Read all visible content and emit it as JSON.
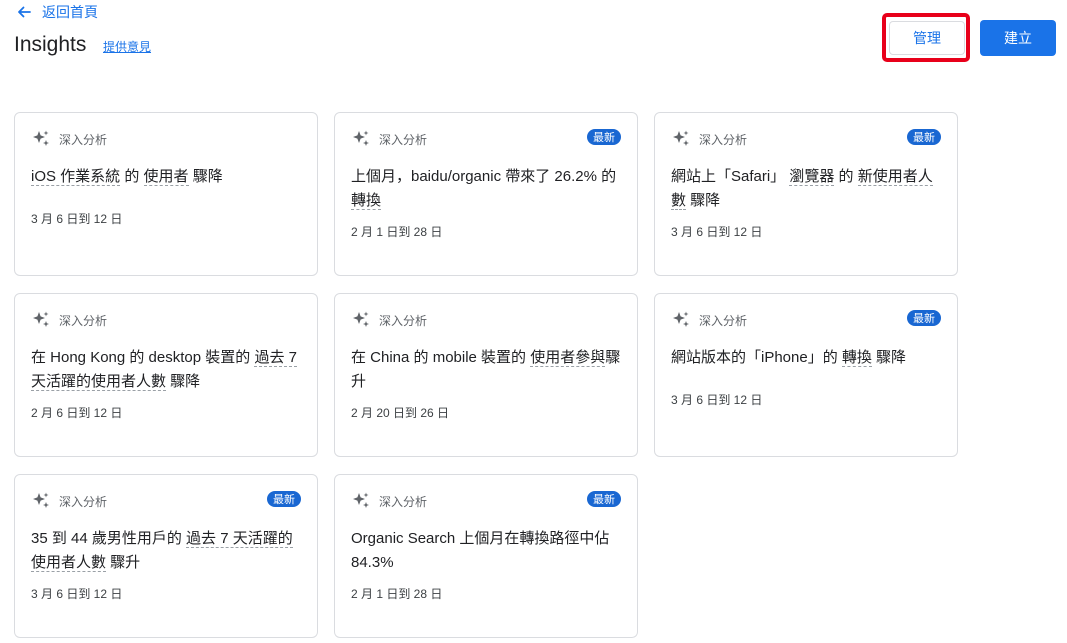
{
  "header": {
    "back_label": "返回首頁",
    "title": "Insights",
    "feedback_label": "提供意見",
    "manage_label": "管理",
    "create_label": "建立"
  },
  "colors": {
    "accent": "#1a73e8",
    "badge": "#1967d2",
    "highlight": "#e8001a"
  },
  "cards": [
    {
      "kind": "深入分析",
      "badge": "",
      "title": [
        [
          "iOS 作業系統",
          true
        ],
        [
          " 的 ",
          false
        ],
        [
          "使用者",
          true
        ],
        [
          " 驟降",
          false
        ]
      ],
      "date": "3 月 6 日到 12 日"
    },
    {
      "kind": "深入分析",
      "badge": "最新",
      "title": [
        [
          "上個月，baidu/organic 帶來了 26.2% 的 ",
          false
        ],
        [
          "轉換",
          true
        ]
      ],
      "date": "2 月 1 日到 28 日"
    },
    {
      "kind": "深入分析",
      "badge": "最新",
      "title": [
        [
          "網站上「Safari」 ",
          false
        ],
        [
          "瀏覽器",
          true
        ],
        [
          " 的 ",
          false
        ],
        [
          "新使用者人數",
          true
        ],
        [
          " 驟降",
          false
        ]
      ],
      "date": "3 月 6 日到 12 日"
    },
    {
      "kind": "深入分析",
      "badge": "",
      "title": [
        [
          "在 Hong Kong 的 desktop 裝置的 ",
          false
        ],
        [
          "過去 7 天活躍的使用者人數",
          true
        ],
        [
          " 驟降",
          false
        ]
      ],
      "date": "2 月 6 日到 12 日"
    },
    {
      "kind": "深入分析",
      "badge": "",
      "title": [
        [
          "在 China 的 mobile 裝置的 ",
          false
        ],
        [
          "使用者參與",
          true
        ],
        [
          "驟升",
          false
        ]
      ],
      "date": "2 月 20 日到 26 日"
    },
    {
      "kind": "深入分析",
      "badge": "最新",
      "title": [
        [
          "網站版本的「iPhone」的 ",
          false
        ],
        [
          "轉換",
          true
        ],
        [
          " 驟降",
          false
        ]
      ],
      "date": "3 月 6 日到 12 日"
    },
    {
      "kind": "深入分析",
      "badge": "最新",
      "title": [
        [
          "35 到 44 歲男性用戶的 ",
          false
        ],
        [
          "過去 7 天活躍的使用者人數",
          true
        ],
        [
          " 驟升",
          false
        ]
      ],
      "date": "3 月 6 日到 12 日"
    },
    {
      "kind": "深入分析",
      "badge": "最新",
      "title": [
        [
          "Organic Search 上個月在轉換路徑中佔 84.3%",
          false
        ]
      ],
      "date": "2 月 1 日到 28 日"
    }
  ]
}
